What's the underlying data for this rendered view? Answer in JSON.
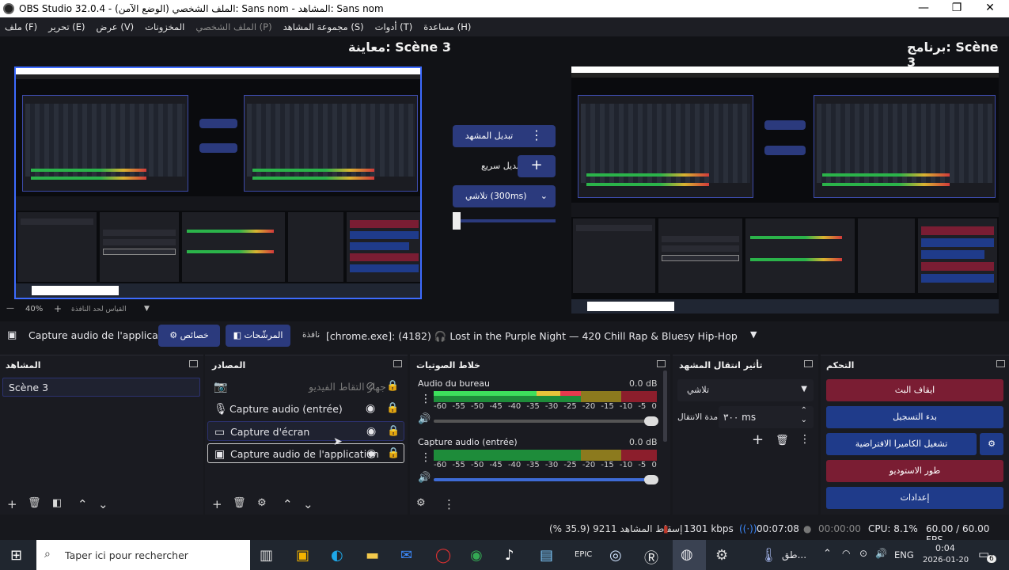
{
  "window": {
    "title": "OBS Studio 32.0.4 - الملف الشخصي (الوضع الآمن): Sans nom - المشاهد: Sans nom",
    "minimize": "—",
    "maximize": "❐",
    "close": "✕"
  },
  "menu": [
    "ملف (F)",
    "تحرير (E)",
    "عرض (V)",
    "المخزونات",
    "الملف الشخصي (P)",
    "مجموعة المشاهد (S)",
    "أدوات (T)",
    "مساعدة (H)"
  ],
  "preview": {
    "preview_label": "معاينة: Scène 3",
    "program_label": "برنامج: Scène 3",
    "zoom": "40%",
    "zoom_mode": "القياس لحد النافذة"
  },
  "transition_mid": {
    "switch_scene": "تبديل المشهد",
    "quick_transition": "تبديل سريع",
    "fade": "تلاشي (300ms)"
  },
  "source_toolbar": {
    "selected": "Capture audio de l'applicat",
    "properties": "خصائص",
    "filters": "المرشّحات",
    "window_label": "نافذة",
    "window_value": "[chrome.exe]: (4182) 🎧 Lost in the Purple Night — 420 Chill Rap & Bluesy Hip-Hop 🎼 🎧 - YouT"
  },
  "scenes": {
    "title": "المشاهد",
    "items": [
      "Scène 3"
    ]
  },
  "sources": {
    "title": "المصادر",
    "items": [
      {
        "name": "جهاز التقاط الفيديو",
        "icon": "camera-icon",
        "disabled": true
      },
      {
        "name": "Capture audio (entrée)",
        "icon": "mic-icon"
      },
      {
        "name": "Capture d'écran",
        "icon": "monitor-icon"
      },
      {
        "name": "Capture audio de l'application",
        "icon": "app-audio-icon"
      }
    ]
  },
  "mixer": {
    "title": "خلاط الصوتيات",
    "channels": [
      {
        "name": "Audio du bureau",
        "db": "0.0 dB",
        "level": 0.66
      },
      {
        "name": "Capture audio (entrée)",
        "db": "0.0 dB",
        "level": 0.0
      }
    ],
    "scale": [
      "-60",
      "-55",
      "-50",
      "-45",
      "-40",
      "-35",
      "-30",
      "-25",
      "-20",
      "-15",
      "-10",
      "-5",
      "0"
    ]
  },
  "transitions": {
    "title": "تأثير انتقال المشهد",
    "type": "تلاشي",
    "duration_label": "مدة الانتقال",
    "duration_value": "٣٠٠ ms"
  },
  "controls": {
    "title": "التحكم",
    "stop_stream": "ايقاف البث",
    "start_record": "بدء التسجيل",
    "virtual_cam": "تشغيل الكاميرا الافتراضية",
    "studio_mode": "طور الاستوديو",
    "settings": "إعدادات"
  },
  "status": {
    "dropped": "إسقاط المشاهد 9211 (35.9 %)",
    "bitrate": "1301 kbps",
    "stream_time": "00:07:08",
    "rec_time": "00:00:00",
    "cpu": "CPU: 8.1%",
    "fps": "60.00 / 60.00 FPS"
  },
  "taskbar": {
    "search": "Taper ici pour rechercher",
    "weather": "طق...",
    "lang": "ENG",
    "time": "0:04",
    "date": "2026-01-20",
    "notif": "6"
  },
  "colors": {
    "accent": "#2b3a7d",
    "red": "#7a1d33"
  }
}
